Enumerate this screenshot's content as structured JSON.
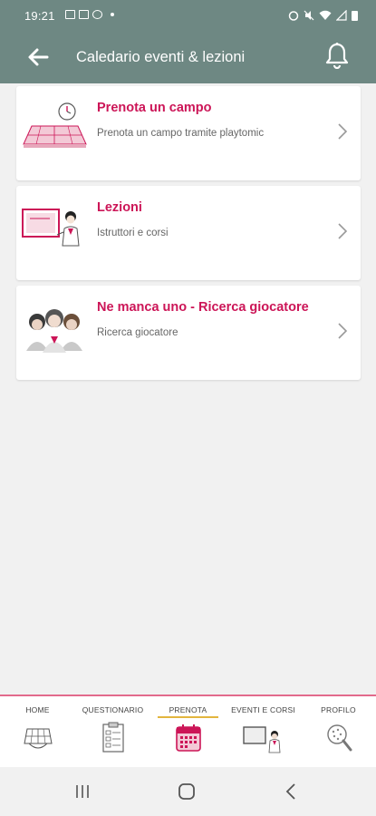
{
  "status_bar": {
    "time": "19:21"
  },
  "app_bar": {
    "title": "Caledario eventi & lezioni"
  },
  "cards": [
    {
      "title": "Prenota un campo",
      "subtitle": "Prenota un campo tramite playtomic"
    },
    {
      "title": "Lezioni",
      "subtitle": "Istruttori e corsi"
    },
    {
      "title": "Ne manca uno - Ricerca giocatore",
      "subtitle": "Ricerca giocatore"
    }
  ],
  "bottom_nav": {
    "items": [
      {
        "label": "HOME",
        "icon": "tennis-court-icon"
      },
      {
        "label": "QUESTIONARIO",
        "icon": "clipboard-icon"
      },
      {
        "label": "PRENOTA",
        "icon": "calendar-icon",
        "active": true
      },
      {
        "label": "EVENTI E CORSI",
        "icon": "teacher-board-icon"
      },
      {
        "label": "PROFILO",
        "icon": "racket-icon"
      }
    ]
  },
  "colors": {
    "header": "#6e8883",
    "accent": "#cc1557",
    "active_underline": "#e2b53e"
  }
}
